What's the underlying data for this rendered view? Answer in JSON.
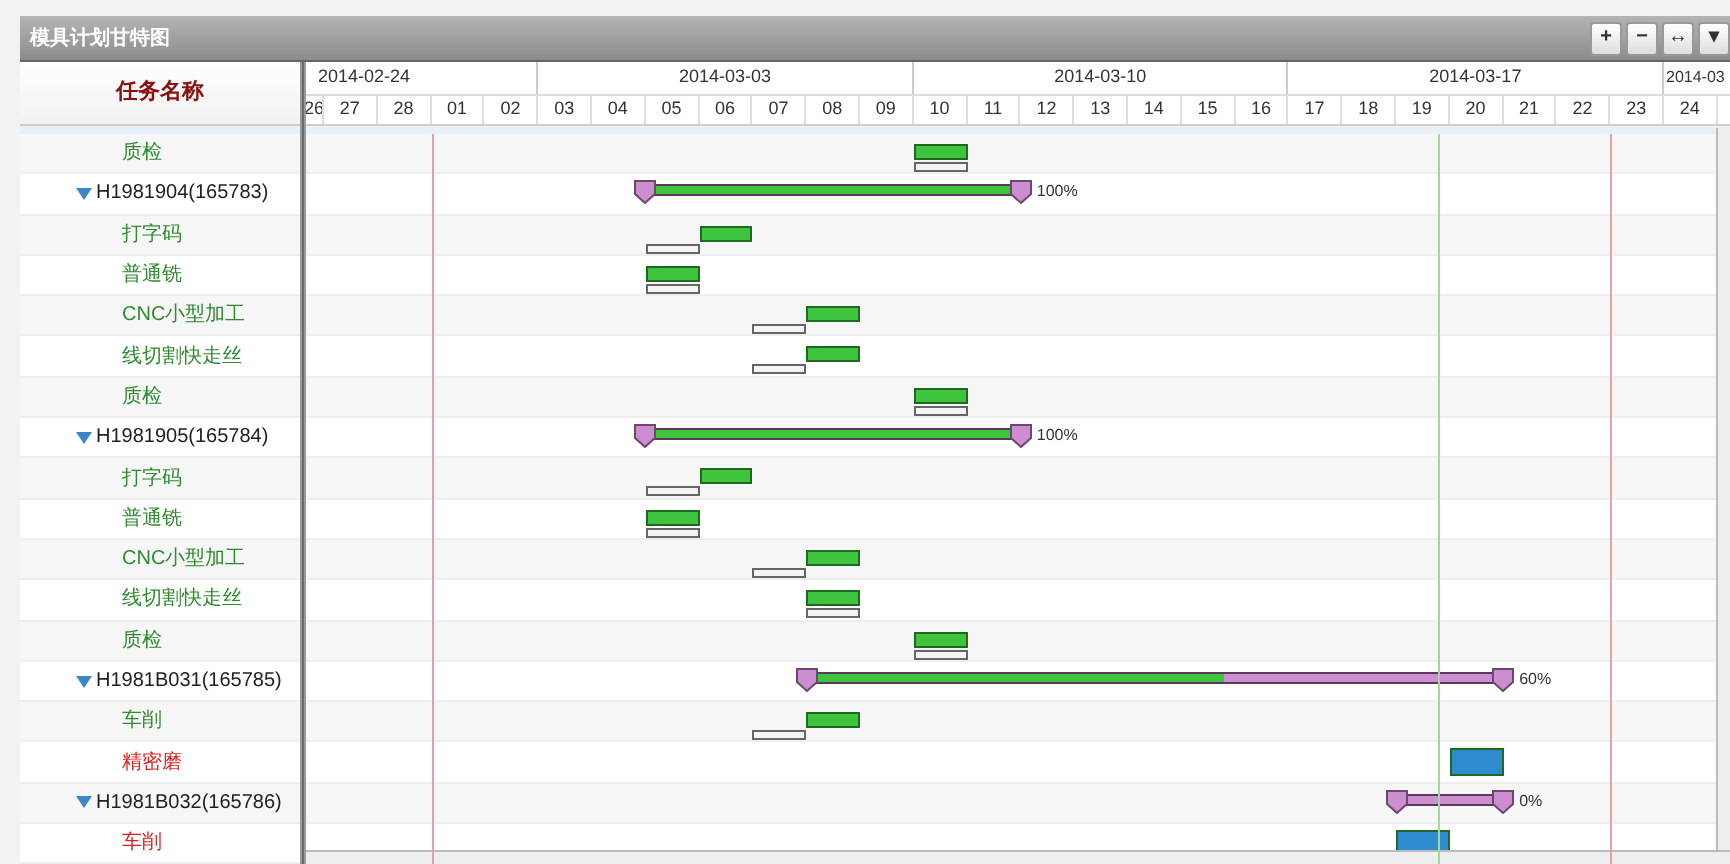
{
  "window": {
    "title": "模具计划甘特图"
  },
  "toolbar": [
    "+",
    "−",
    "↔",
    "▾"
  ],
  "grid": {
    "column_header": "任务名称"
  },
  "timeline": {
    "weeks": [
      "2014-02-24",
      "2014-03-03",
      "2014-03-10",
      "2014-03-17",
      "2014-03"
    ],
    "days": [
      "26",
      "27",
      "28",
      "01",
      "02",
      "03",
      "04",
      "05",
      "06",
      "07",
      "08",
      "09",
      "10",
      "11",
      "12",
      "13",
      "14",
      "15",
      "16",
      "17",
      "18",
      "19",
      "20",
      "21",
      "22",
      "23",
      "24"
    ]
  },
  "rows": [
    {
      "kind": "task",
      "name": "质检",
      "color": "#2e8b2e",
      "bar": {
        "color": "#3ec43e"
      },
      "planned": true
    },
    {
      "kind": "summary",
      "name": "H1981904(165783)",
      "expanded": true,
      "level": 1,
      "progress": "100%"
    },
    {
      "kind": "task",
      "name": "打字码",
      "color": "#2e8b2e",
      "bar": {
        "color": "#3ec43e"
      },
      "planned": true
    },
    {
      "kind": "task",
      "name": "普通铣",
      "color": "#2e8b2e",
      "bar": {
        "color": "#3ec43e"
      },
      "planned": true
    },
    {
      "kind": "task",
      "name": "CNC小型加工",
      "color": "#2e8b2e",
      "bar": {
        "color": "#3ec43e"
      },
      "planned": true
    },
    {
      "kind": "task",
      "name": "线切割快走丝",
      "color": "#2e8b2e",
      "bar": {
        "color": "#3ec43e"
      },
      "planned": true
    },
    {
      "kind": "task",
      "name": "质检",
      "color": "#2e8b2e",
      "bar": {
        "color": "#3ec43e"
      },
      "planned": true
    },
    {
      "kind": "summary",
      "name": "H1981905(165784)",
      "expanded": true,
      "level": 1,
      "progress": "100%"
    },
    {
      "kind": "task",
      "name": "打字码",
      "color": "#2e8b2e",
      "bar": {
        "color": "#3ec43e"
      },
      "planned": true
    },
    {
      "kind": "task",
      "name": "普通铣",
      "color": "#2e8b2e",
      "bar": {
        "color": "#3ec43e"
      },
      "planned": true
    },
    {
      "kind": "task",
      "name": "CNC小型加工",
      "color": "#2e8b2e",
      "bar": {
        "color": "#3ec43e"
      },
      "planned": true
    },
    {
      "kind": "task",
      "name": "线切割快走丝",
      "color": "#2e8b2e",
      "bar": {
        "color": "#3ec43e"
      },
      "planned": true
    },
    {
      "kind": "task",
      "name": "质检",
      "color": "#2e8b2e",
      "bar": {
        "color": "#3ec43e"
      },
      "planned": true
    },
    {
      "kind": "summary",
      "name": "H1981B031(165785)",
      "expanded": true,
      "level": 0.6,
      "progress": "60%"
    },
    {
      "kind": "task",
      "name": "车削",
      "color": "#2e8b2e",
      "bar": {
        "color": "#3ec43e"
      },
      "planned": true
    },
    {
      "kind": "task",
      "name": "精密磨",
      "color": "#e02020",
      "bar": {
        "color": "#2e8bd0"
      },
      "planned": false
    },
    {
      "kind": "summary",
      "name": "H1981B032(165786)",
      "expanded": true,
      "level": 0,
      "progress": "0%"
    },
    {
      "kind": "task",
      "name": "车削",
      "color": "#e02020",
      "bar": {
        "color": "#2e8bd0"
      },
      "planned": false
    }
  ]
}
